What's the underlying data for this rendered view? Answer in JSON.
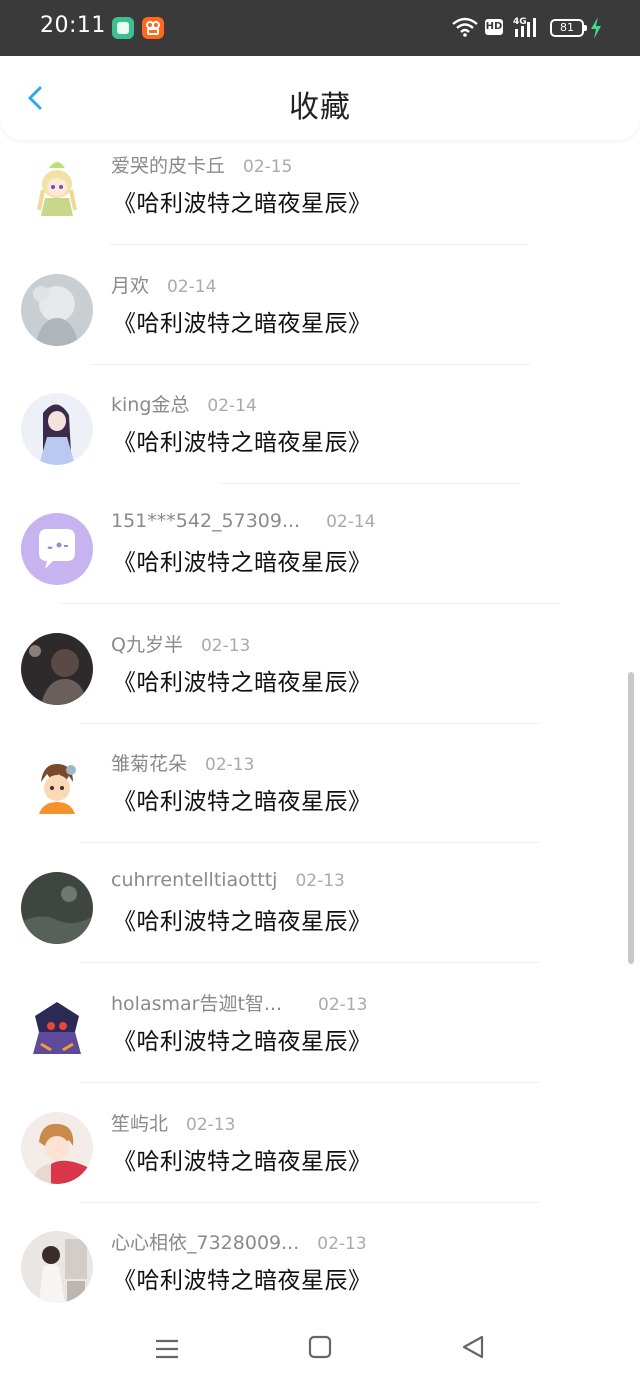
{
  "status_bar": {
    "time": "20:11",
    "hd": "HD",
    "network": "4G",
    "battery": "81"
  },
  "header": {
    "title": "收藏"
  },
  "items": [
    {
      "user": "爱哭的皮卡丘",
      "date": "02-15",
      "title": "《哈利波特之暗夜星辰》"
    },
    {
      "user": "月欢",
      "date": "02-14",
      "title": "《哈利波特之暗夜星辰》"
    },
    {
      "user": "king金总",
      "date": "02-14",
      "title": "《哈利波特之暗夜星辰》"
    },
    {
      "user": "151***542_57309...",
      "date": "02-14",
      "title": "《哈利波特之暗夜星辰》"
    },
    {
      "user": "Q九岁半",
      "date": "02-13",
      "title": "《哈利波特之暗夜星辰》"
    },
    {
      "user": "雏菊花朵",
      "date": "02-13",
      "title": "《哈利波特之暗夜星辰》"
    },
    {
      "user": "cuhrrentelltiaotttj",
      "date": "02-13",
      "title": "《哈利波特之暗夜星辰》"
    },
    {
      "user": "holasmar告迦t智...",
      "date": "02-13",
      "title": "《哈利波特之暗夜星辰》"
    },
    {
      "user": "笙屿北",
      "date": "02-13",
      "title": "《哈利波特之暗夜星辰》"
    },
    {
      "user": "心心相依_7328009...",
      "date": "02-13",
      "title": "《哈利波特之暗夜星辰》"
    }
  ],
  "colors": {
    "accent": "#2aa8f0",
    "status_bar_bg": "#3a3a3a",
    "charging": "#3ddc84"
  }
}
